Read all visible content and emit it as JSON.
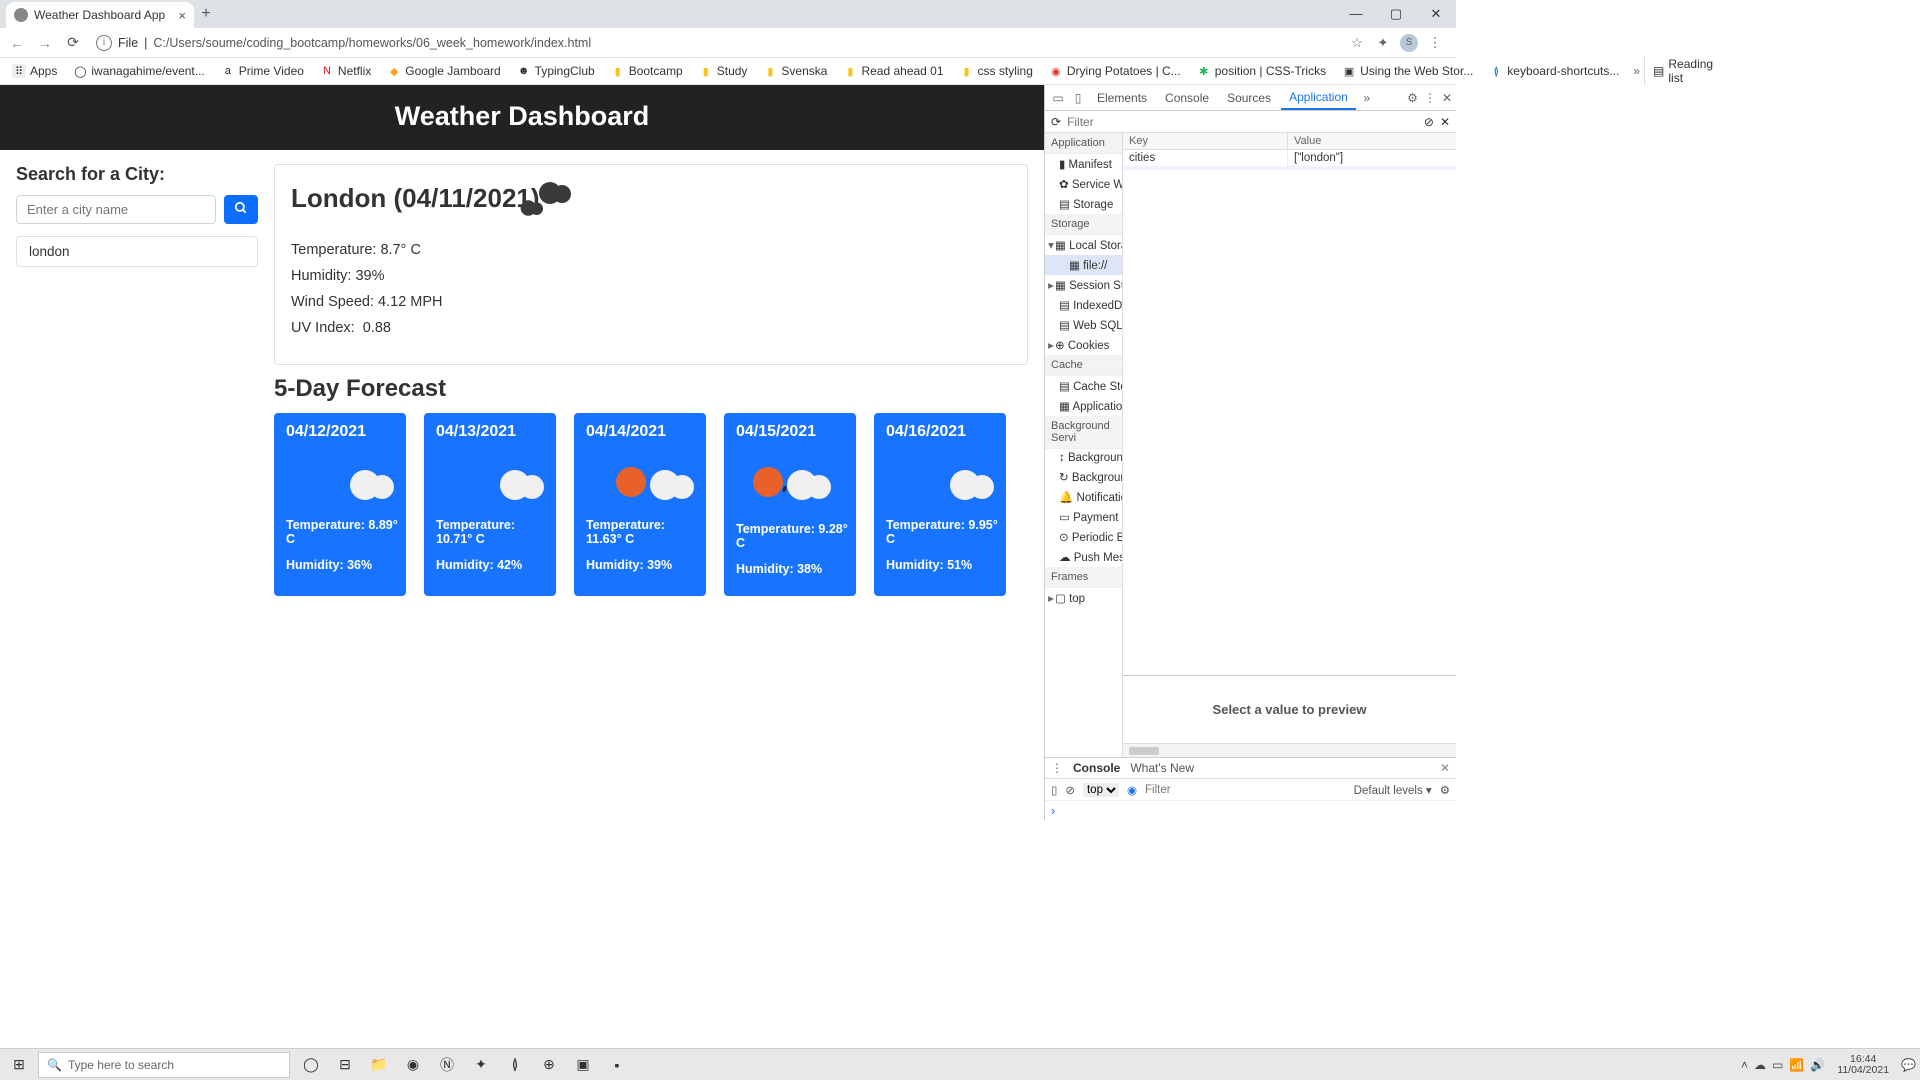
{
  "browser": {
    "tab_title": "Weather Dashboard App",
    "url_scheme": "File",
    "url_path": "C:/Users/soume/coding_bootcamp/homeworks/06_week_homework/index.html",
    "bookmarks": [
      "Apps",
      "iwanagahime/event...",
      "Prime Video",
      "Netflix",
      "Google Jamboard",
      "TypingClub",
      "Bootcamp",
      "Study",
      "Svenska",
      "Read ahead 01",
      "css styling",
      "Drying Potatoes | C...",
      "position | CSS-Tricks",
      "Using the Web Stor...",
      "keyboard-shortcuts..."
    ],
    "reading_list": "Reading list"
  },
  "app": {
    "header": "Weather Dashboard",
    "search_heading": "Search for a City:",
    "search_placeholder": "Enter a city name",
    "history": [
      "london"
    ],
    "today": {
      "title": "London (04/11/2021)",
      "temp": "Temperature: 8.7° C",
      "humidity": "Humidity: 39%",
      "wind": "Wind Speed: 4.12 MPH",
      "uv_label": "UV Index:",
      "uv_value": "0.88"
    },
    "forecast_title": "5-Day Forecast",
    "forecast": [
      {
        "date": "04/12/2021",
        "icon": "cloud",
        "temp": "Temperature: 8.89° C",
        "hum": "Humidity: 36%"
      },
      {
        "date": "04/13/2021",
        "icon": "cloud",
        "temp": "Temperature: 10.71° C",
        "hum": "Humidity: 42%"
      },
      {
        "date": "04/14/2021",
        "icon": "sun-cloud",
        "temp": "Temperature: 11.63° C",
        "hum": "Humidity: 39%"
      },
      {
        "date": "04/15/2021",
        "icon": "sun-cloud-rain",
        "temp": "Temperature: 9.28° C",
        "hum": "Humidity: 38%"
      },
      {
        "date": "04/16/2021",
        "icon": "cloud",
        "temp": "Temperature: 9.95° C",
        "hum": "Humidity: 51%"
      }
    ]
  },
  "devtools": {
    "tabs": [
      "Elements",
      "Console",
      "Sources",
      "Application"
    ],
    "active_tab": "Application",
    "filter_placeholder": "Filter",
    "left_heading": "Application",
    "left_items_app": [
      "Manifest",
      "Service Wo",
      "Storage"
    ],
    "section_storage": "Storage",
    "storage_items": [
      {
        "label": "Local Stora",
        "expand": true
      },
      {
        "label": "file://",
        "indent": true,
        "sel": true
      },
      {
        "label": "Session Sto",
        "expand": true
      },
      {
        "label": "IndexedDB"
      },
      {
        "label": "Web SQL"
      },
      {
        "label": "Cookies",
        "expand": true
      }
    ],
    "section_cache": "Cache",
    "cache_items": [
      "Cache Stor",
      "Applicatior"
    ],
    "section_bg": "Background Servi",
    "bg_items": [
      "Backgroun",
      "Backgroun",
      "Notificatio",
      "Payment H",
      "Periodic Ba",
      "Push Mess"
    ],
    "section_frames": "Frames",
    "frames_items": [
      "top"
    ],
    "kv_header": [
      "Key",
      "Value"
    ],
    "kv_rows": [
      {
        "k": "cities",
        "v": "[\"london\"]"
      }
    ],
    "preview_text": "Select a value to preview",
    "console_tabs": [
      "Console",
      "What's New"
    ],
    "console_top": "top",
    "console_filter": "Filter",
    "console_levels": "Default levels ▾",
    "console_prompt": "›"
  },
  "taskbar": {
    "search_placeholder": "Type here to search",
    "time": "16:44",
    "date": "11/04/2021"
  }
}
